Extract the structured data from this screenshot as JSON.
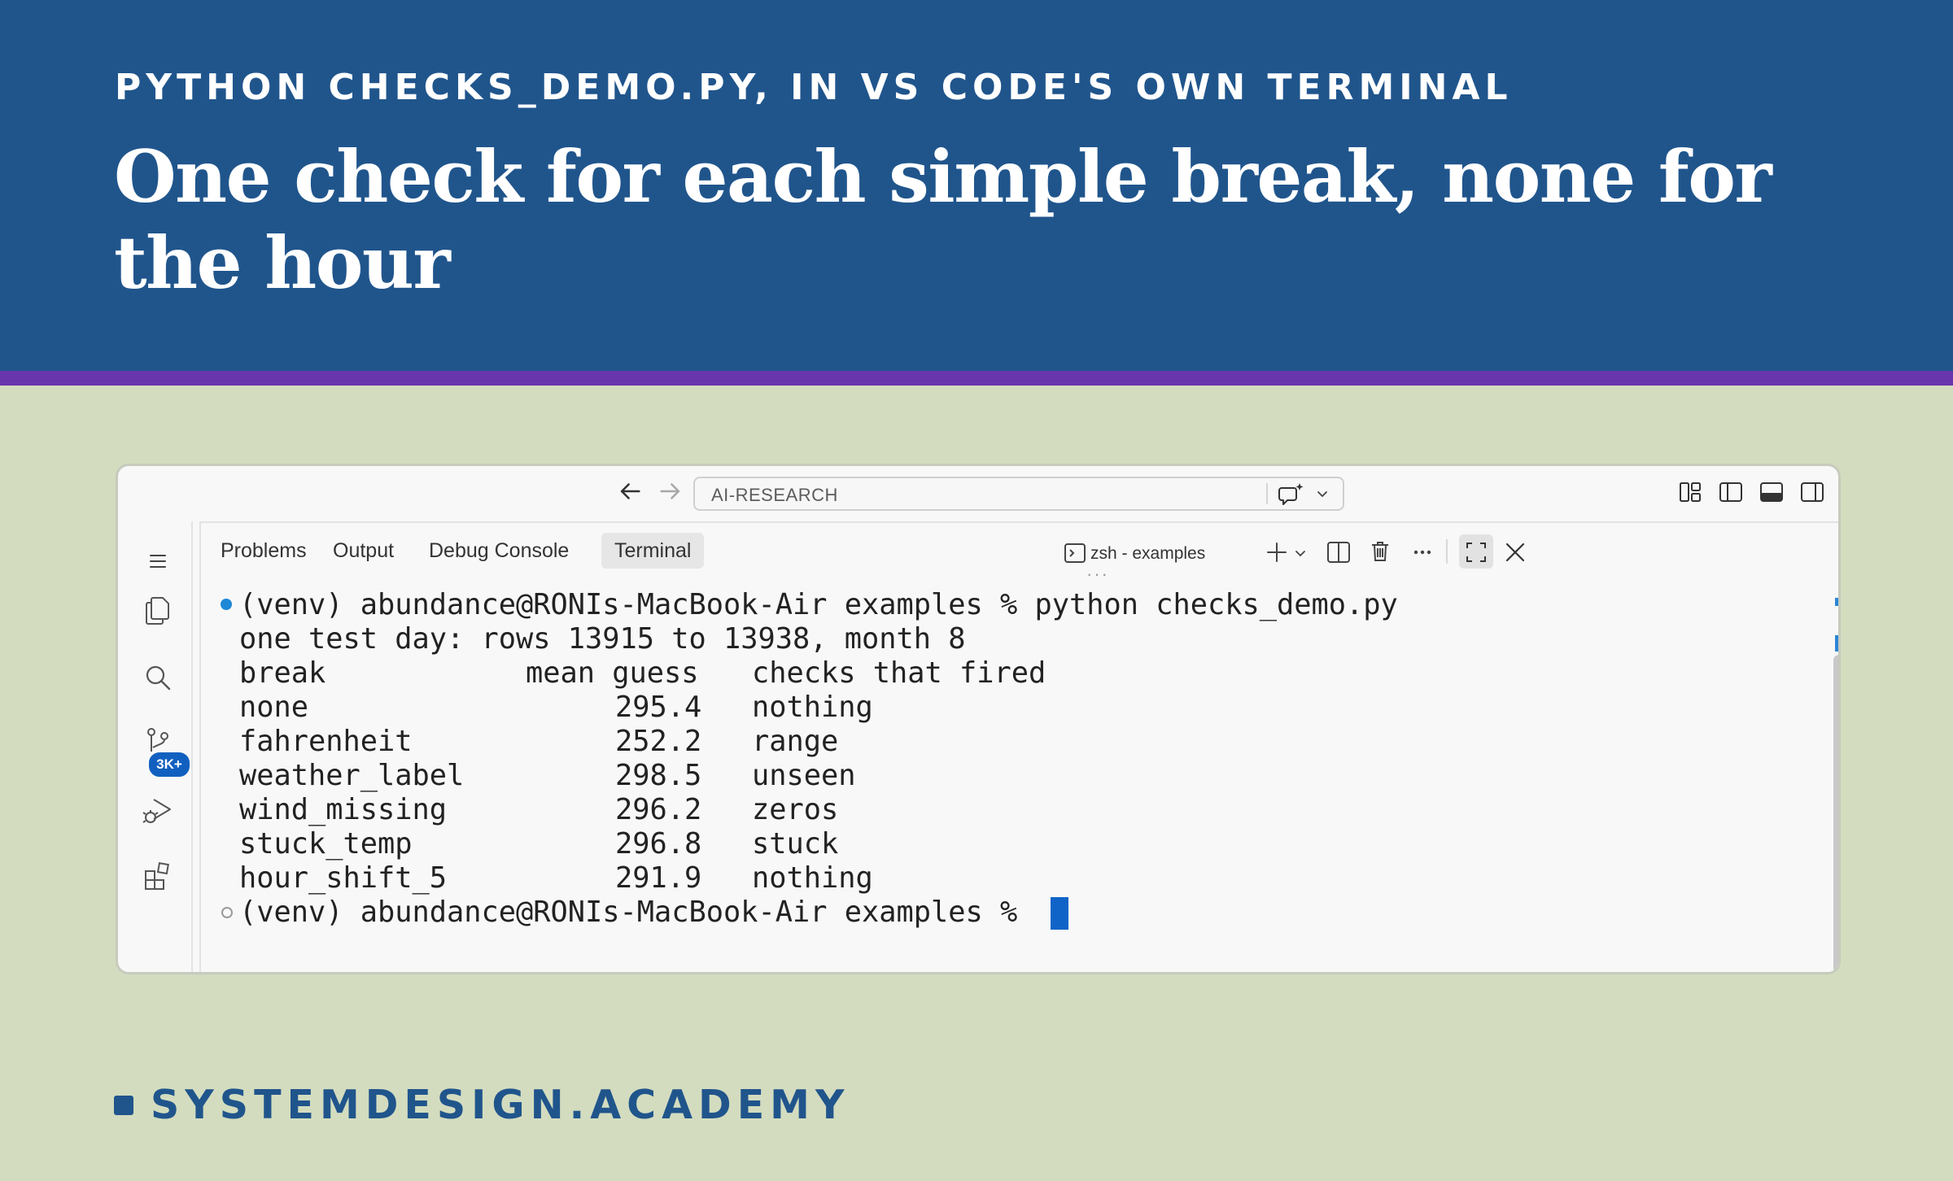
{
  "slide": {
    "kicker": "PYTHON CHECKS_DEMO.PY, IN VS CODE'S OWN TERMINAL",
    "headline": "One check for each simple break, none for the hour",
    "brand": "SYSTEMDESIGN.ACADEMY",
    "colors": {
      "header_bg": "#20558c",
      "accent_stripe": "#6935ad",
      "page_bg": "#d3dcbf",
      "cursor": "#1064c8",
      "badge": "#1160c0"
    }
  },
  "window": {
    "search_text": "AI-RESEARCH",
    "icons": {
      "back": "arrow-left-icon",
      "forward": "arrow-right-icon",
      "chat": "chat-sparkle-icon",
      "layouts": [
        "customize-layout-icon",
        "toggle-primary-sidebar-icon",
        "toggle-panel-icon",
        "toggle-secondary-sidebar-icon"
      ]
    },
    "activity_bar": {
      "items": [
        "menu-icon",
        "explorer-icon",
        "search-icon",
        "source-control-icon",
        "run-debug-icon",
        "extensions-icon"
      ],
      "source_control_badge": "3K+"
    },
    "panel": {
      "tabs": [
        "Problems",
        "Output",
        "Debug Console",
        "Terminal"
      ],
      "active_tab": "Terminal",
      "terminal_name": "zsh - examples",
      "actions": [
        "new-terminal-icon",
        "chevron-down-icon",
        "split-terminal-icon",
        "trash-icon",
        "more-icon",
        "maximize-icon",
        "close-icon"
      ]
    },
    "terminal": {
      "command_line": "(venv) abundance@RONIs-MacBook-Air examples % python checks_demo.py",
      "info_line": "one test day: rows 13915 to 13938, month 8",
      "table": {
        "headers": [
          "break",
          "mean guess",
          "checks that fired"
        ],
        "rows": [
          [
            "none",
            "295.4",
            "nothing"
          ],
          [
            "fahrenheit",
            "252.2",
            "range"
          ],
          [
            "weather_label",
            "298.5",
            "unseen"
          ],
          [
            "wind_missing",
            "296.2",
            "zeros"
          ],
          [
            "stuck_temp",
            "296.8",
            "stuck"
          ],
          [
            "hour_shift_5",
            "291.9",
            "nothing"
          ]
        ]
      },
      "prompt_line": "(venv) abundance@RONIs-MacBook-Air examples % "
    }
  }
}
